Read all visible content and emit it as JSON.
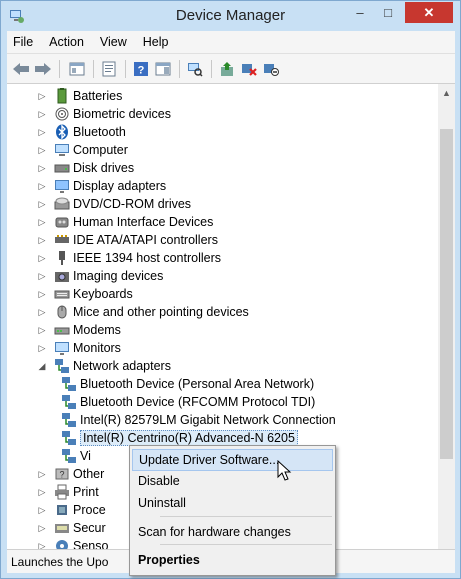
{
  "window": {
    "title": "Device Manager",
    "minimize": "–",
    "maximize": "□",
    "close": "✕"
  },
  "menu": [
    "File",
    "Action",
    "View",
    "Help"
  ],
  "toolbar": [
    "back",
    "forward",
    "up-tree",
    "properties",
    "help",
    "show-hide",
    "scan",
    "update-driver",
    "uninstall",
    "disable"
  ],
  "tree": [
    {
      "label": "Batteries",
      "icon": "battery-icon",
      "expanded": false,
      "indent": 0
    },
    {
      "label": "Biometric devices",
      "icon": "fingerprint-icon",
      "expanded": false,
      "indent": 0
    },
    {
      "label": "Bluetooth",
      "icon": "bluetooth-icon",
      "expanded": false,
      "indent": 0
    },
    {
      "label": "Computer",
      "icon": "computer-icon",
      "expanded": false,
      "indent": 0
    },
    {
      "label": "Disk drives",
      "icon": "disk-icon",
      "expanded": false,
      "indent": 0
    },
    {
      "label": "Display adapters",
      "icon": "display-icon",
      "expanded": false,
      "indent": 0
    },
    {
      "label": "DVD/CD-ROM drives",
      "icon": "dvd-icon",
      "expanded": false,
      "indent": 0
    },
    {
      "label": "Human Interface Devices",
      "icon": "hid-icon",
      "expanded": false,
      "indent": 0
    },
    {
      "label": "IDE ATA/ATAPI controllers",
      "icon": "ide-icon",
      "expanded": false,
      "indent": 0
    },
    {
      "label": "IEEE 1394 host controllers",
      "icon": "ieee1394-icon",
      "expanded": false,
      "indent": 0
    },
    {
      "label": "Imaging devices",
      "icon": "camera-icon",
      "expanded": false,
      "indent": 0
    },
    {
      "label": "Keyboards",
      "icon": "keyboard-icon",
      "expanded": false,
      "indent": 0
    },
    {
      "label": "Mice and other pointing devices",
      "icon": "mouse-icon",
      "expanded": false,
      "indent": 0
    },
    {
      "label": "Modems",
      "icon": "modem-icon",
      "expanded": false,
      "indent": 0
    },
    {
      "label": "Monitors",
      "icon": "monitor-icon",
      "expanded": false,
      "indent": 0
    },
    {
      "label": "Network adapters",
      "icon": "network-icon",
      "expanded": true,
      "indent": 0
    },
    {
      "label": "Bluetooth Device (Personal Area Network)",
      "icon": "network-icon",
      "indent": 1
    },
    {
      "label": "Bluetooth Device (RFCOMM Protocol TDI)",
      "icon": "network-icon",
      "indent": 1
    },
    {
      "label": "Intel(R) 82579LM Gigabit Network Connection",
      "icon": "network-icon",
      "indent": 1
    },
    {
      "label": "Intel(R) Centrino(R) Advanced-N 6205",
      "icon": "network-icon",
      "indent": 1,
      "selected": true
    },
    {
      "label": "Vi",
      "icon": "network-icon",
      "indent": 1
    },
    {
      "label": "Other",
      "icon": "other-icon",
      "expanded": false,
      "indent": 0
    },
    {
      "label": "Print",
      "icon": "printer-icon",
      "expanded": false,
      "indent": 0
    },
    {
      "label": "Proce",
      "icon": "processor-icon",
      "expanded": false,
      "indent": 0
    },
    {
      "label": "Secur",
      "icon": "security-icon",
      "expanded": false,
      "indent": 0
    },
    {
      "label": "Senso",
      "icon": "sensor-icon",
      "expanded": false,
      "indent": 0
    }
  ],
  "status": "Launches the Upo",
  "context_menu": [
    {
      "label": "Update Driver Software...",
      "hover": true
    },
    {
      "label": "Disable"
    },
    {
      "label": "Uninstall"
    },
    {
      "sep": true
    },
    {
      "label": "Scan for hardware changes"
    },
    {
      "sep": true
    },
    {
      "label": "Properties",
      "bold": true
    }
  ],
  "colors": {
    "title_bg": "#c8e0f4",
    "close_bg": "#c7372f",
    "selection": "#ddecf9",
    "menu_hover": "#d5e5f6"
  }
}
